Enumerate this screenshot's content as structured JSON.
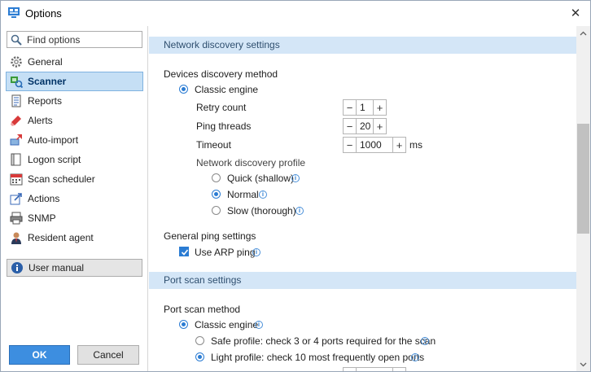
{
  "window": {
    "title": "Options",
    "close_glyph": "✕"
  },
  "sidebar": {
    "search_placeholder": "Find options",
    "items": [
      {
        "label": "General",
        "icon": "gear-icon",
        "active": false
      },
      {
        "label": "Scanner",
        "icon": "scanner-icon",
        "active": true
      },
      {
        "label": "Reports",
        "icon": "reports-icon",
        "active": false
      },
      {
        "label": "Alerts",
        "icon": "alerts-icon",
        "active": false
      },
      {
        "label": "Auto-import",
        "icon": "auto-import-icon",
        "active": false
      },
      {
        "label": "Logon script",
        "icon": "logon-script-icon",
        "active": false
      },
      {
        "label": "Scan scheduler",
        "icon": "calendar-icon",
        "active": false
      },
      {
        "label": "Actions",
        "icon": "actions-icon",
        "active": false
      },
      {
        "label": "SNMP",
        "icon": "snmp-icon",
        "active": false
      },
      {
        "label": "Resident agent",
        "icon": "agent-icon",
        "active": false
      }
    ],
    "user_manual": "User manual",
    "ok": "OK",
    "cancel": "Cancel"
  },
  "network_discovery": {
    "header": "Network discovery settings",
    "method_label": "Devices discovery method",
    "classic_engine": "Classic engine",
    "retry_count": {
      "label": "Retry count",
      "value": "1"
    },
    "ping_threads": {
      "label": "Ping threads",
      "value": "20"
    },
    "timeout": {
      "label": "Timeout",
      "value": "1000",
      "unit": "ms"
    },
    "profile_label": "Network discovery profile",
    "profiles": [
      {
        "label": "Quick (shallow)",
        "selected": false
      },
      {
        "label": "Normal",
        "selected": true
      },
      {
        "label": "Slow (thorough)",
        "selected": false
      }
    ]
  },
  "general_ping": {
    "label": "General ping settings",
    "use_arp": {
      "label": "Use ARP ping",
      "checked": true
    }
  },
  "port_scan": {
    "header": "Port scan settings",
    "method_label": "Port scan method",
    "classic_engine": "Classic engine",
    "profiles": [
      {
        "label": "Safe profile: check 3 or 4 ports required for the scan",
        "selected": false
      },
      {
        "label": "Light profile: check 10 most frequently open ports",
        "selected": true
      }
    ]
  },
  "stepper": {
    "minus": "−",
    "plus": "+"
  },
  "info_glyph": "i",
  "colors": {
    "accent": "#2b7cd3",
    "section_bg": "#d4e6f7",
    "ok_bg": "#3d8ee0",
    "active_bg": "#c5dff5"
  }
}
